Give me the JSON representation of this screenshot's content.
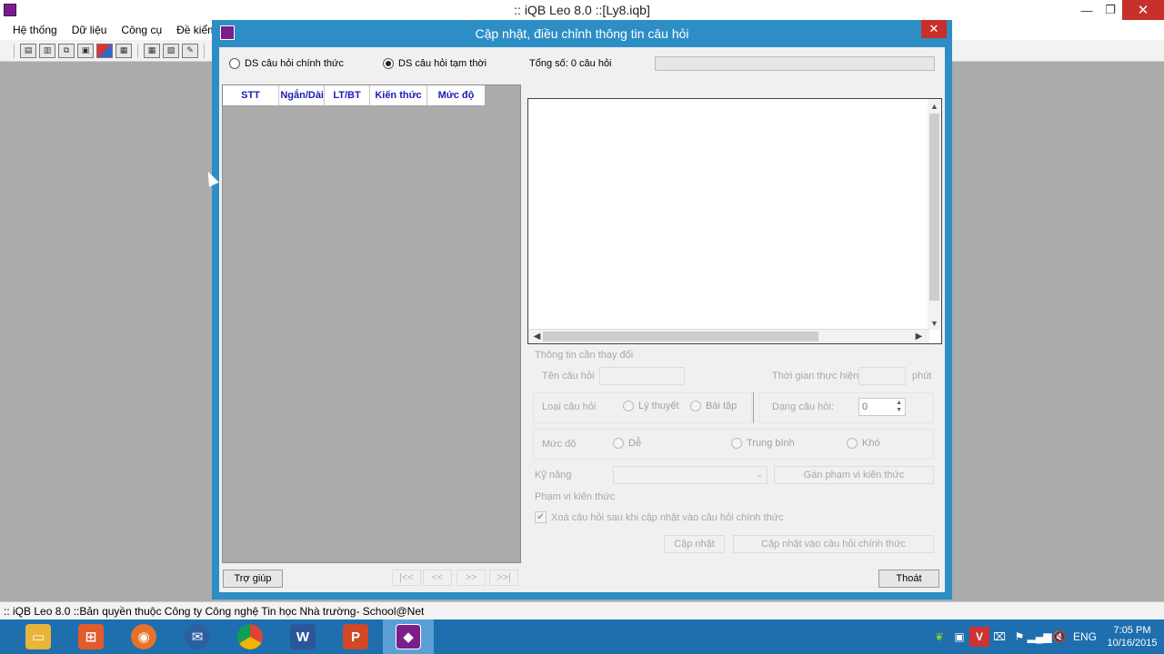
{
  "app": {
    "title": ":: iQB Leo 8.0 ::[Ly8.iqb]",
    "controls": {
      "minimize": "—",
      "restore": "❐",
      "close": "✕"
    },
    "menu": [
      "Hệ thống",
      "Dữ liệu",
      "Công cụ",
      "Đề kiểm"
    ],
    "status": ":: iQB Leo 8.0 ::Bản quyền thuộc Công ty Công nghệ Tin học Nhà trường- School@Net"
  },
  "dialog": {
    "title": "Cập nhật, điều chỉnh thông tin câu hỏi",
    "close": "✕",
    "radio_official": "DS câu hỏi chính thức",
    "radio_temp": "DS câu hỏi tạm thời",
    "total": "Tổng số: 0 câu hỏi",
    "grid_columns": [
      "STT",
      "Ngắn/Dài",
      "LT/BT",
      "Kiến thức",
      "Mức độ"
    ],
    "info": {
      "group_title": "Thông tin cần thay đổi",
      "name_label": "Tên câu hỏi",
      "time_label": "Thời gian thực hiện",
      "time_unit": "phút",
      "type_label": "Loại câu hỏi",
      "type_theory": "Lý thuyết",
      "type_exercise": "Bài tập",
      "form_label": "Dạng câu hỏi:",
      "form_value": "0",
      "level_label": "Mức độ",
      "level_easy": "Dễ",
      "level_medium": "Trung bình",
      "level_hard": "Khó",
      "skill_label": "Kỹ năng",
      "assign_scope": "Gán phạm vi kiến thức",
      "scope_label": "Phạm vi kiến thức",
      "delete_after": "Xoá câu hỏi sau khi cập nhật vào câu hỏi chính thức",
      "update": "Cập nhật",
      "update_official": "Cập nhật vào câu hỏi chính thức"
    },
    "help": "Trợ giúp",
    "nav": [
      "|<<",
      "<<",
      ">>",
      ">>|"
    ],
    "exit": "Thoát"
  },
  "taskbar": {
    "apps": [
      "File Explorer",
      "Remote",
      "Firefox",
      "Thunderbird",
      "Chrome",
      "Word",
      "PowerPoint",
      "iQB Leo"
    ],
    "language": "ENG",
    "time": "7:05 PM",
    "date": "10/16/2015"
  }
}
